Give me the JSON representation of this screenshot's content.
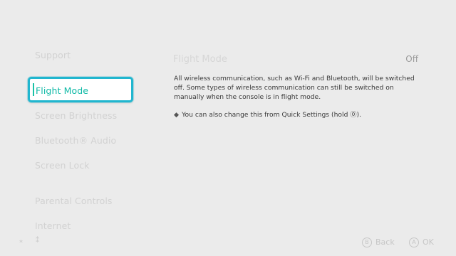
{
  "sidebar": {
    "items": [
      {
        "label": "Support"
      },
      {
        "label": "Flight Mode"
      },
      {
        "label": "Screen Brightness"
      },
      {
        "label": "Bluetooth® Audio"
      },
      {
        "label": "Screen Lock"
      },
      {
        "label": "Parental Controls"
      },
      {
        "label": "Internet"
      }
    ]
  },
  "main": {
    "title": "Flight Mode",
    "value": "Off",
    "description": "All wireless communication, such as Wi-Fi and Bluetooth, will be switched off. Some types of wireless communication can still be switched on manually when the console is in flight mode.",
    "note": "You can also change this from Quick Settings (hold ⓪)."
  },
  "footer": {
    "back_icon": "B",
    "back_label": "Back",
    "ok_icon": "A",
    "ok_label": "OK"
  },
  "colors": {
    "accent": "#21b6cf",
    "selected_text": "#0fb9a6",
    "background": "#ebebeb"
  }
}
